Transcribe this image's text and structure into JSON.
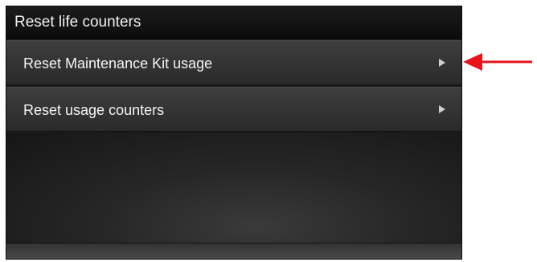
{
  "screen": {
    "title": "Reset life counters"
  },
  "menu": {
    "items": [
      {
        "label": "Reset Maintenance Kit usage",
        "icon": "chevron-right-icon"
      },
      {
        "label": "Reset usage counters",
        "icon": "chevron-right-icon"
      }
    ]
  },
  "annotation": {
    "arrow_color": "#e8141c",
    "icon": "arrow-left-icon"
  }
}
